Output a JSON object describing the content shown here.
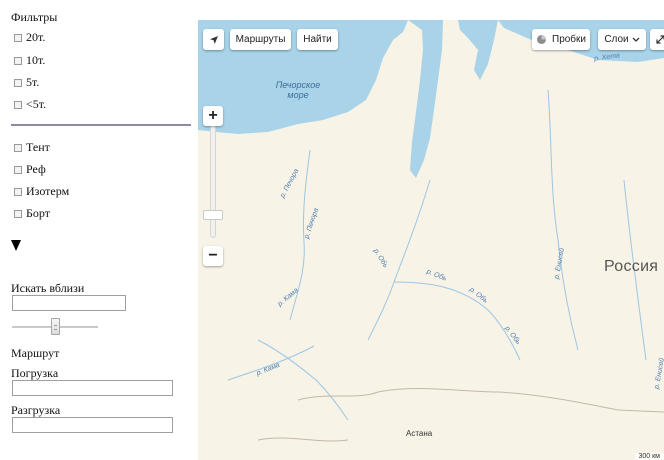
{
  "filters": {
    "title": "Фильтры",
    "tonnage": [
      {
        "label": "20т.",
        "checked": false
      },
      {
        "label": "10т.",
        "checked": false
      },
      {
        "label": "5т.",
        "checked": false
      },
      {
        "label": "<5т.",
        "checked": false
      }
    ],
    "body_types": [
      {
        "label": "Тент",
        "checked": false
      },
      {
        "label": "Реф",
        "checked": false
      },
      {
        "label": "Изотерм",
        "checked": false
      },
      {
        "label": "Борт",
        "checked": false
      }
    ]
  },
  "search_nearby": {
    "label": "Искать вблизи",
    "value": ""
  },
  "route": {
    "title": "Маршрут",
    "loading": {
      "label": "Погрузка",
      "value": ""
    },
    "unloading": {
      "label": "Разгрузка",
      "value": ""
    }
  },
  "map": {
    "buttons": {
      "routes": "Маршруты",
      "find": "Найти",
      "traffic": "Пробки",
      "layers": "Слои"
    },
    "labels": {
      "sea": "Печорское море",
      "country": "Россия",
      "city": "Астана",
      "scale": "300 км"
    },
    "rivers": [
      "р. Хета",
      "р. Печора",
      "р. Печора",
      "р. Обь",
      "р. Обь",
      "р. Обь",
      "р. Обь",
      "р. Кама",
      "р. Кама",
      "р. Енисей",
      "р. Енисей"
    ],
    "colors": {
      "water": "#a8d3e8",
      "land": "#f7f3e6",
      "river": "#9cc6e4",
      "border": "#c3b8a8"
    }
  }
}
